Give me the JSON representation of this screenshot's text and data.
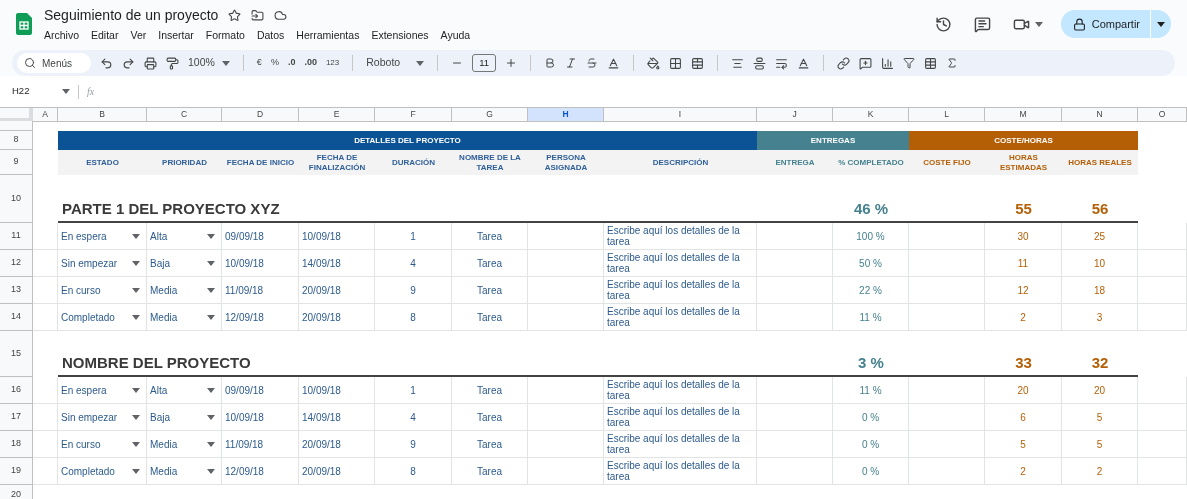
{
  "document": {
    "title": "Seguimiento de un proyecto",
    "menu": [
      "Archivo",
      "Editar",
      "Ver",
      "Insertar",
      "Formato",
      "Datos",
      "Herramientas",
      "Extensiones",
      "Ayuda"
    ],
    "share_label": "Compartir"
  },
  "toolbar": {
    "search_placeholder": "Menús",
    "zoom": "100%",
    "currency": "€",
    "percent": "%",
    "decrease_decimals": ".0",
    "increase_decimals": ".00",
    "number_format": "123",
    "font": "Roboto",
    "font_size": "11"
  },
  "formula_bar": {
    "name_box": "H22",
    "fx": "fx"
  },
  "column_letters": [
    {
      "label": "A",
      "selected": false
    },
    {
      "label": "B",
      "selected": false
    },
    {
      "label": "C",
      "selected": false
    },
    {
      "label": "D",
      "selected": false
    },
    {
      "label": "E",
      "selected": false
    },
    {
      "label": "F",
      "selected": false
    },
    {
      "label": "G",
      "selected": false
    },
    {
      "label": "H",
      "selected": true
    },
    {
      "label": "I",
      "selected": false
    },
    {
      "label": "J",
      "selected": false
    },
    {
      "label": "K",
      "selected": false
    },
    {
      "label": "L",
      "selected": false
    },
    {
      "label": "M",
      "selected": false
    },
    {
      "label": "N",
      "selected": false
    },
    {
      "label": "O",
      "selected": false
    }
  ],
  "sheet": {
    "group_row": "8",
    "header_row": "9",
    "groups": [
      {
        "label": "DETALLES DEL PROYECTO",
        "color": "#0b5394",
        "headers": [
          "ESTADO",
          "PRIORIDAD",
          "FECHA DE INICIO",
          "FECHA DE FINALIZACIÓN",
          "DURACIÓN",
          "NOMBRE DE LA TAREA",
          "PERSONA ASIGNADA",
          "DESCRIPCIÓN"
        ]
      },
      {
        "label": "ENTREGAS",
        "color": "#45818e",
        "headers": [
          "ENTREGA",
          "% COMPLETADO"
        ]
      },
      {
        "label": "COSTE/HORAS",
        "color": "#b45f06",
        "headers": [
          "COSTE FIJO",
          "HORAS ESTIMADAS",
          "HORAS REALES"
        ]
      }
    ],
    "sections": [
      {
        "row": "10",
        "title": "PARTE 1 DEL PROYECTO XYZ",
        "completed": "46 %",
        "estimated": "55",
        "actual": "56",
        "tasks": [
          {
            "row": "11",
            "status": "En espera",
            "priority": "Alta",
            "start": "09/09/18",
            "end": "10/09/18",
            "duration": "1",
            "name": "Tarea",
            "description": "Escribe aquí los detalles de la tarea",
            "completed": "100 %",
            "estimated": "30",
            "actual": "25"
          },
          {
            "row": "12",
            "status": "Sin empezar",
            "priority": "Baja",
            "start": "10/09/18",
            "end": "14/09/18",
            "duration": "4",
            "name": "Tarea",
            "description": "Escribe aquí los detalles de la tarea",
            "completed": "50 %",
            "estimated": "11",
            "actual": "10"
          },
          {
            "row": "13",
            "status": "En curso",
            "priority": "Media",
            "start": "11/09/18",
            "end": "20/09/18",
            "duration": "9",
            "name": "Tarea",
            "description": "Escribe aquí los detalles de la tarea",
            "completed": "22 %",
            "estimated": "12",
            "actual": "18"
          },
          {
            "row": "14",
            "status": "Completado",
            "priority": "Media",
            "start": "12/09/18",
            "end": "20/09/18",
            "duration": "8",
            "name": "Tarea",
            "description": "Escribe aquí los detalles de la tarea",
            "completed": "11 %",
            "estimated": "2",
            "actual": "3"
          }
        ]
      },
      {
        "row": "15",
        "title": "NOMBRE DEL PROYECTO",
        "completed": "3 %",
        "estimated": "33",
        "actual": "32",
        "tasks": [
          {
            "row": "16",
            "status": "En espera",
            "priority": "Alta",
            "start": "09/09/18",
            "end": "10/09/18",
            "duration": "1",
            "name": "Tarea",
            "description": "Escribe aquí los detalles de la tarea",
            "completed": "11 %",
            "estimated": "20",
            "actual": "20"
          },
          {
            "row": "17",
            "status": "Sin empezar",
            "priority": "Baja",
            "start": "10/09/18",
            "end": "14/09/18",
            "duration": "4",
            "name": "Tarea",
            "description": "Escribe aquí los detalles de la tarea",
            "completed": "0 %",
            "estimated": "6",
            "actual": "5"
          },
          {
            "row": "18",
            "status": "En curso",
            "priority": "Media",
            "start": "11/09/18",
            "end": "20/09/18",
            "duration": "9",
            "name": "Tarea",
            "description": "Escribe aquí los detalles de la tarea",
            "completed": "0 %",
            "estimated": "5",
            "actual": "5"
          },
          {
            "row": "19",
            "status": "Completado",
            "priority": "Media",
            "start": "12/09/18",
            "end": "20/09/18",
            "duration": "8",
            "name": "Tarea",
            "description": "Escribe aquí los detalles de la tarea",
            "completed": "0 %",
            "estimated": "2",
            "actual": "2"
          }
        ]
      }
    ],
    "trailing_row": "20"
  }
}
